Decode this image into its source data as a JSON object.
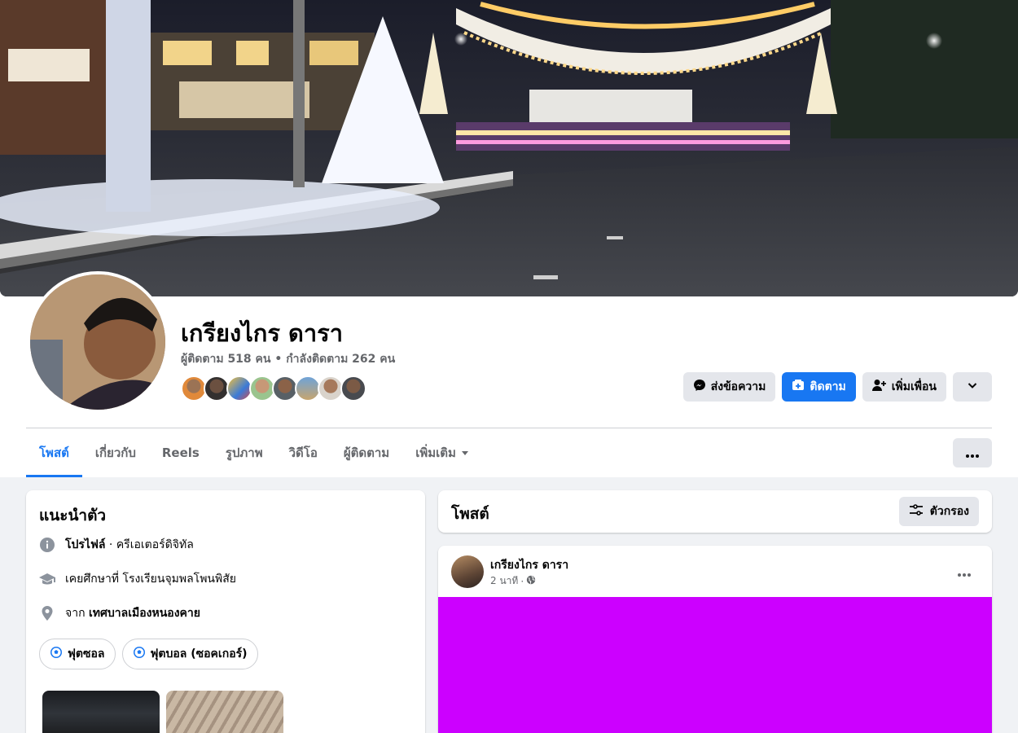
{
  "colors": {
    "accent": "#1877f2",
    "page_bg": "#f0f2f5",
    "post_media": "#cc00ff"
  },
  "profile": {
    "name": "เกรียงไกร ดารา",
    "followers_text": "ผู้ติดตาม 518 คน",
    "following_text": "กำลังติดตาม 262 คน",
    "separator": " • "
  },
  "actions": {
    "message": "ส่งข้อความ",
    "follow": "ติดตาม",
    "add_friend": "เพิ่มเพื่อน"
  },
  "tabs": [
    {
      "label": "โพสต์",
      "active": true
    },
    {
      "label": "เกี่ยวกับ"
    },
    {
      "label": "Reels"
    },
    {
      "label": "รูปภาพ"
    },
    {
      "label": "วิดีโอ"
    },
    {
      "label": "ผู้ติดตาม"
    },
    {
      "label": "เพิ่มเติม"
    }
  ],
  "intro": {
    "title": "แนะนำตัว",
    "profile_label": "โปรไฟล์",
    "profile_value": " · ครีเอเตอร์ดิจิทัล",
    "education": "เคยศึกษาที่ โรงเรียนจุมพลโพนพิสัย",
    "from_prefix": "จาก ",
    "from_value": "เทศบาลเมืองหนองคาย",
    "hobbies": [
      "ฟุตซอล",
      "ฟุตบอล (ซอคเกอร์)"
    ]
  },
  "posts": {
    "title": "โพสต์",
    "filter_label": "ตัวกรอง",
    "first": {
      "author": "เกรียงไกร ดารา",
      "time": "2 นาที",
      "meta_sep": " · "
    }
  }
}
